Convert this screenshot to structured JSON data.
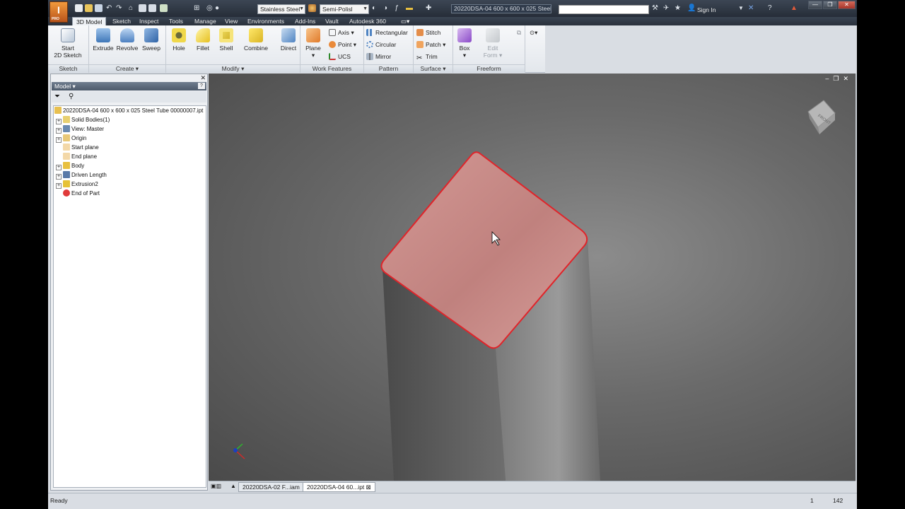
{
  "title_bar": {
    "app_badge": "I",
    "app_badge_sub": "PRO",
    "material": "Stainless Steel",
    "appearance": "Semi-Polisl",
    "document_title": "20220DSA-04 600 x 600 x 025 Steel T...",
    "sign_in": "Sign In"
  },
  "tabs": [
    "3D Model",
    "Sketch",
    "Inspect",
    "Tools",
    "Manage",
    "View",
    "Environments",
    "Add-Ins",
    "Vault",
    "Autodesk 360"
  ],
  "ribbon": {
    "sketch": {
      "label": "Sketch",
      "start_line1": "Start",
      "start_line2": "2D Sketch"
    },
    "create": {
      "label": "Create",
      "extrude": "Extrude",
      "revolve": "Revolve",
      "sweep": "Sweep"
    },
    "modify": {
      "label": "Modify",
      "hole": "Hole",
      "fillet": "Fillet",
      "shell": "Shell",
      "combine": "Combine",
      "direct": "Direct"
    },
    "work_features": {
      "label": "Work Features",
      "plane": "Plane",
      "axis": "Axis",
      "point": "Point",
      "ucs": "UCS"
    },
    "pattern": {
      "label": "Pattern",
      "rectangular": "Rectangular",
      "circular": "Circular",
      "mirror": "Mirror"
    },
    "surface": {
      "label": "Surface",
      "stitch": "Stitch",
      "patch": "Patch",
      "trim": "Trim"
    },
    "freeform": {
      "label": "Freeform",
      "box": "Box",
      "edit_line1": "Edit",
      "edit_line2": "Form"
    }
  },
  "browser": {
    "header": "Model",
    "tree": [
      {
        "label": "20220DSA-04 600 x 600 x 025 Steel Tube 00000007.ipt",
        "icon": "part-icon",
        "expandable": false,
        "indent": 0
      },
      {
        "label": "Solid Bodies(1)",
        "icon": "solid-bodies-icon",
        "expandable": true,
        "indent": 1
      },
      {
        "label": "View: Master",
        "icon": "view-icon",
        "expandable": true,
        "indent": 1
      },
      {
        "label": "Origin",
        "icon": "folder-icon",
        "expandable": true,
        "indent": 1
      },
      {
        "label": "Start plane",
        "icon": "plane-icon",
        "expandable": false,
        "indent": 1
      },
      {
        "label": "End plane",
        "icon": "plane-icon",
        "expandable": false,
        "indent": 1
      },
      {
        "label": "Body",
        "icon": "body-icon",
        "expandable": true,
        "indent": 1
      },
      {
        "label": "Driven Length",
        "icon": "parameter-icon",
        "expandable": true,
        "indent": 1
      },
      {
        "label": "Extrusion2",
        "icon": "extrusion-icon",
        "expandable": true,
        "indent": 1
      },
      {
        "label": "End of Part",
        "icon": "end-of-part-icon",
        "expandable": false,
        "indent": 1
      }
    ]
  },
  "viewcube": {
    "face": "FRONT"
  },
  "document_tabs": [
    {
      "label": "20220DSA-02 F...iam",
      "active": false
    },
    {
      "label": "20220DSA-04 60...ipt",
      "active": true
    }
  ],
  "status": {
    "text": "Ready",
    "count1": "1",
    "count2": "142"
  },
  "colors": {
    "selection": "#e0242a",
    "face_fill": "#c88a88",
    "title_bar": "#2e3642",
    "tab_bar": "#333c48"
  }
}
